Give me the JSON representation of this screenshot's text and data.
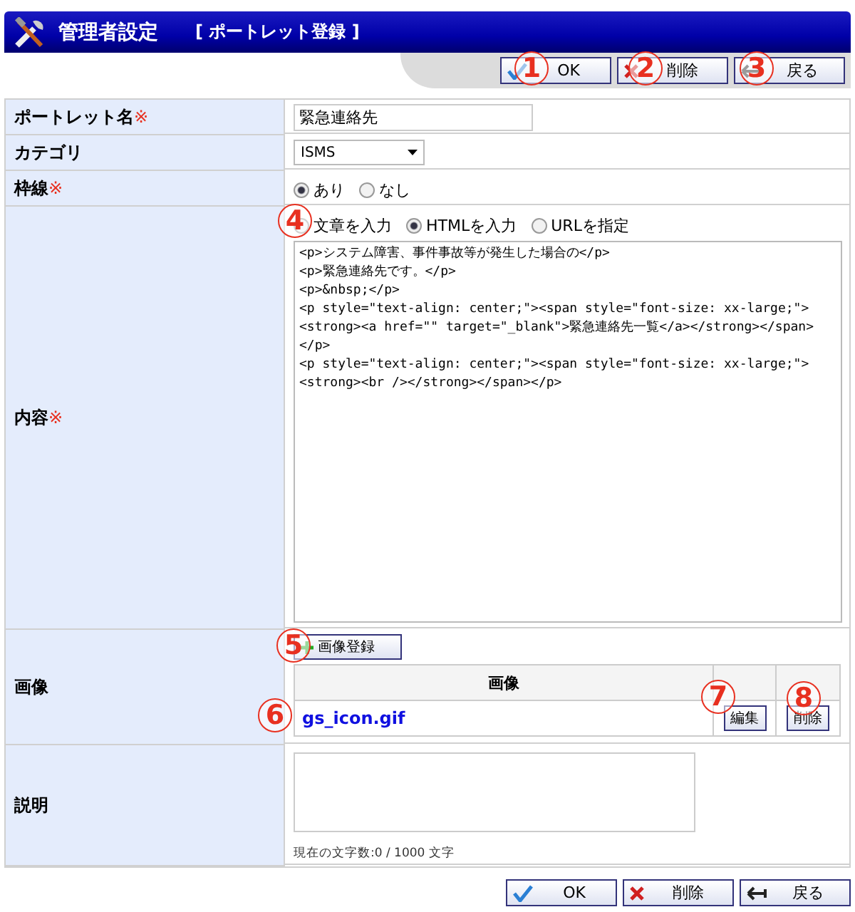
{
  "header": {
    "title": "管理者設定",
    "subtitle": "[ ポートレット登録 ]"
  },
  "top_buttons": [
    {
      "kind": "ok",
      "label": "OK"
    },
    {
      "kind": "delete",
      "label": "削除"
    },
    {
      "kind": "back",
      "label": "戻る"
    }
  ],
  "portlet_name": {
    "label": "ポートレット名",
    "required_mark": "※",
    "value": "緊急連絡先"
  },
  "category": {
    "label": "カテゴリ",
    "value": "ISMS"
  },
  "frame": {
    "label": "枠線",
    "required_mark": "※",
    "options": [
      {
        "label": "あり",
        "selected": true
      },
      {
        "label": "なし",
        "selected": false
      }
    ]
  },
  "content": {
    "label": "内容",
    "required_mark": "※",
    "options": [
      {
        "label": "文章を入力",
        "selected": false
      },
      {
        "label": "HTMLを入力",
        "selected": true
      },
      {
        "label": "URLを指定",
        "selected": false
      }
    ],
    "lines": [
      "<p>システム障害、事件事故等が発生した場合の</p>",
      "<p>緊急連絡先です。</p>",
      "<p>&nbsp;</p>",
      "<p style=\"text-align: center;\"><span style=\"font-size: xx-large;\">",
      "<strong><a href=\"\" target=\"_blank\">緊急連絡先一覧</a></strong></span>",
      "</p>",
      "<p style=\"text-align: center;\"><span style=\"font-size: xx-large;\">",
      "<strong><br /></strong></span></p>"
    ]
  },
  "image": {
    "label": "画像",
    "add_button": "画像登録",
    "column": "画像",
    "rows": [
      {
        "file": "gs_icon.gif",
        "edit": "編集",
        "delete": "削除"
      }
    ]
  },
  "description": {
    "label": "説明",
    "counter": "現在の文字数:0 / 1000 文字"
  },
  "bottom_buttons": [
    {
      "kind": "ok",
      "label": "OK"
    },
    {
      "kind": "delete",
      "label": "削除"
    },
    {
      "kind": "back",
      "label": "戻る"
    }
  ],
  "callouts": [
    "1",
    "2",
    "3",
    "4",
    "5",
    "6",
    "7",
    "8"
  ]
}
